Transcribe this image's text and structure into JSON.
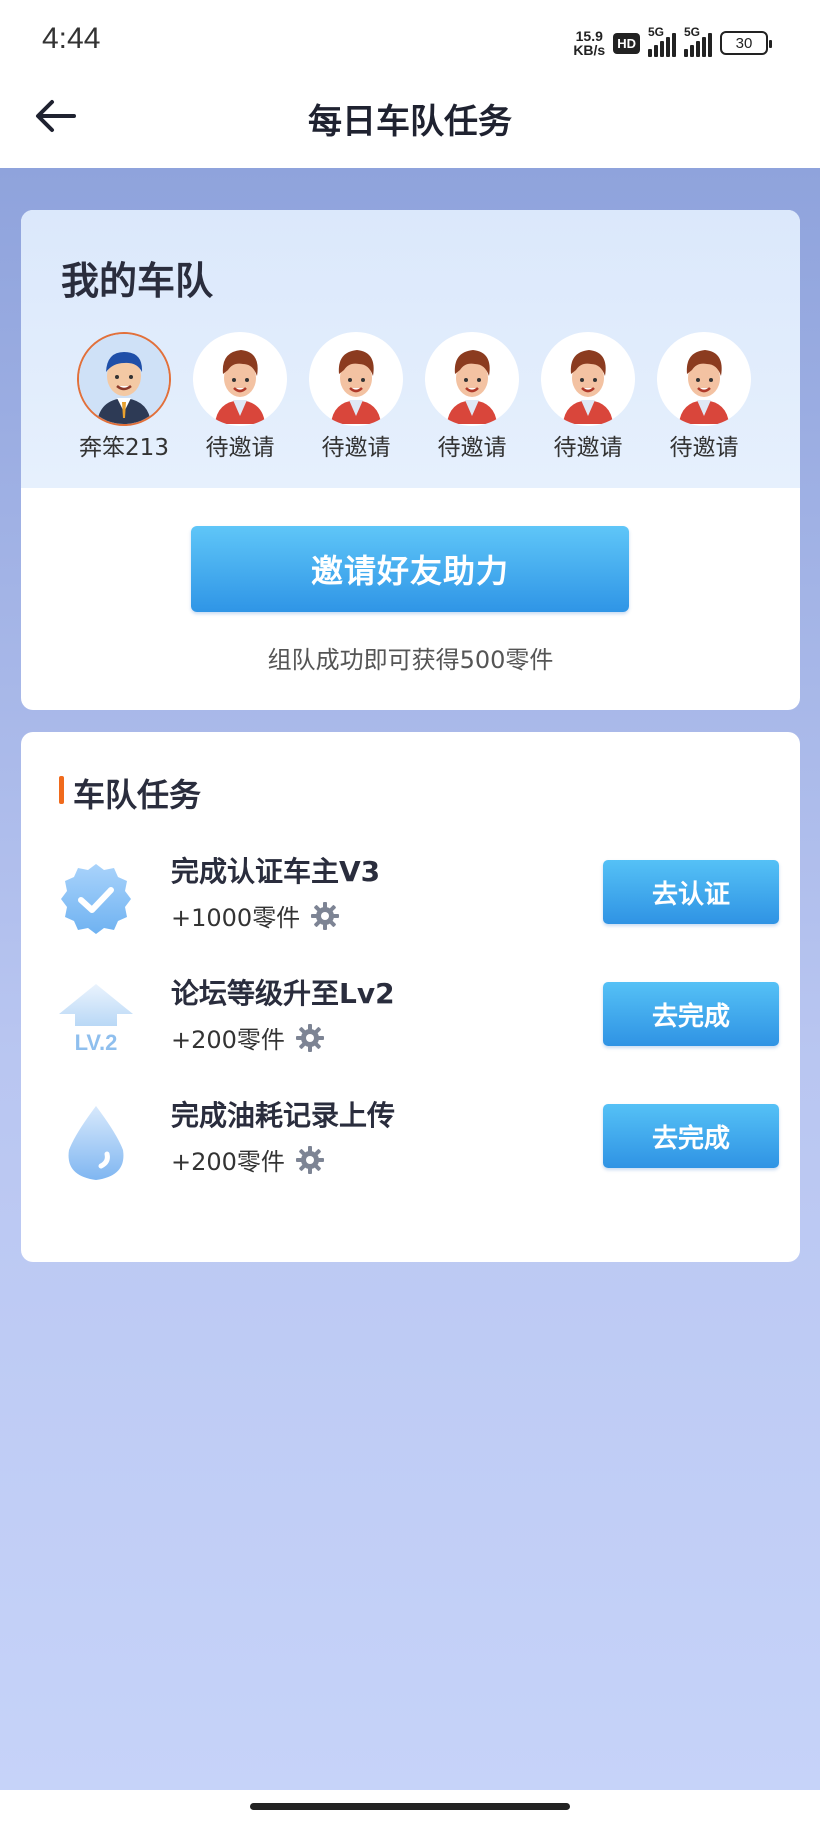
{
  "status_bar": {
    "time": "4:44",
    "net_speed_value": "15.9",
    "net_speed_unit": "KB/s",
    "hd_label": "HD",
    "signal1_label": "5G",
    "signal2_label": "5G",
    "battery": "30"
  },
  "header": {
    "title": "每日车队任务",
    "back_icon": "arrow-left-icon"
  },
  "team": {
    "title": "我的车队",
    "members": [
      {
        "name": "奔笨213",
        "type": "owner"
      },
      {
        "name": "待邀请",
        "type": "pending"
      },
      {
        "name": "待邀请",
        "type": "pending"
      },
      {
        "name": "待邀请",
        "type": "pending"
      },
      {
        "name": "待邀请",
        "type": "pending"
      },
      {
        "name": "待邀请",
        "type": "pending"
      }
    ],
    "invite_button": "邀请好友助力",
    "reward_text": "组队成功即可获得500零件"
  },
  "tasks": {
    "title": "车队任务",
    "items": [
      {
        "name": "完成认证车主V3",
        "reward": "+1000零件",
        "button": "去认证",
        "icon": "verified-badge-icon"
      },
      {
        "name": "论坛等级升至Lv2",
        "reward": "+200零件",
        "button": "去完成",
        "icon": "level-up-icon",
        "icon_text": "LV.2"
      },
      {
        "name": "完成油耗记录上传",
        "reward": "+200零件",
        "button": "去完成",
        "icon": "fuel-drop-icon"
      }
    ]
  },
  "colors": {
    "accent_blue": "#2f95e6",
    "title_marker": "#f06a1c",
    "page_bg": "#b9c6f1"
  }
}
